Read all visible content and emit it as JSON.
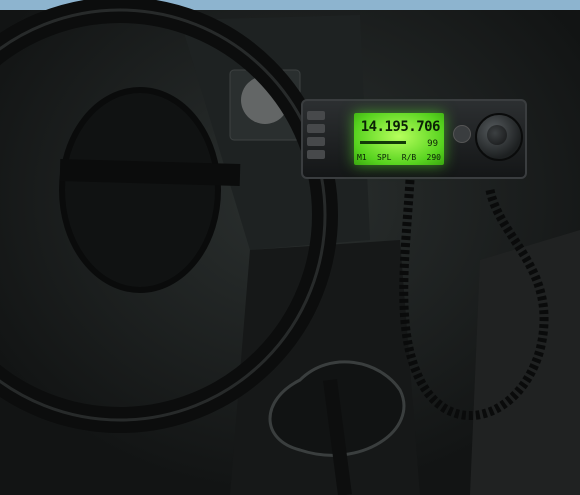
{
  "display": {
    "frequency": "14.195.706",
    "meter_number": "99",
    "bottom_labels": [
      "M1",
      "SPL",
      "R/B",
      "290"
    ]
  },
  "colors": {
    "lcd_green": "#7be62f",
    "interior_dark": "#1a1d1d"
  }
}
